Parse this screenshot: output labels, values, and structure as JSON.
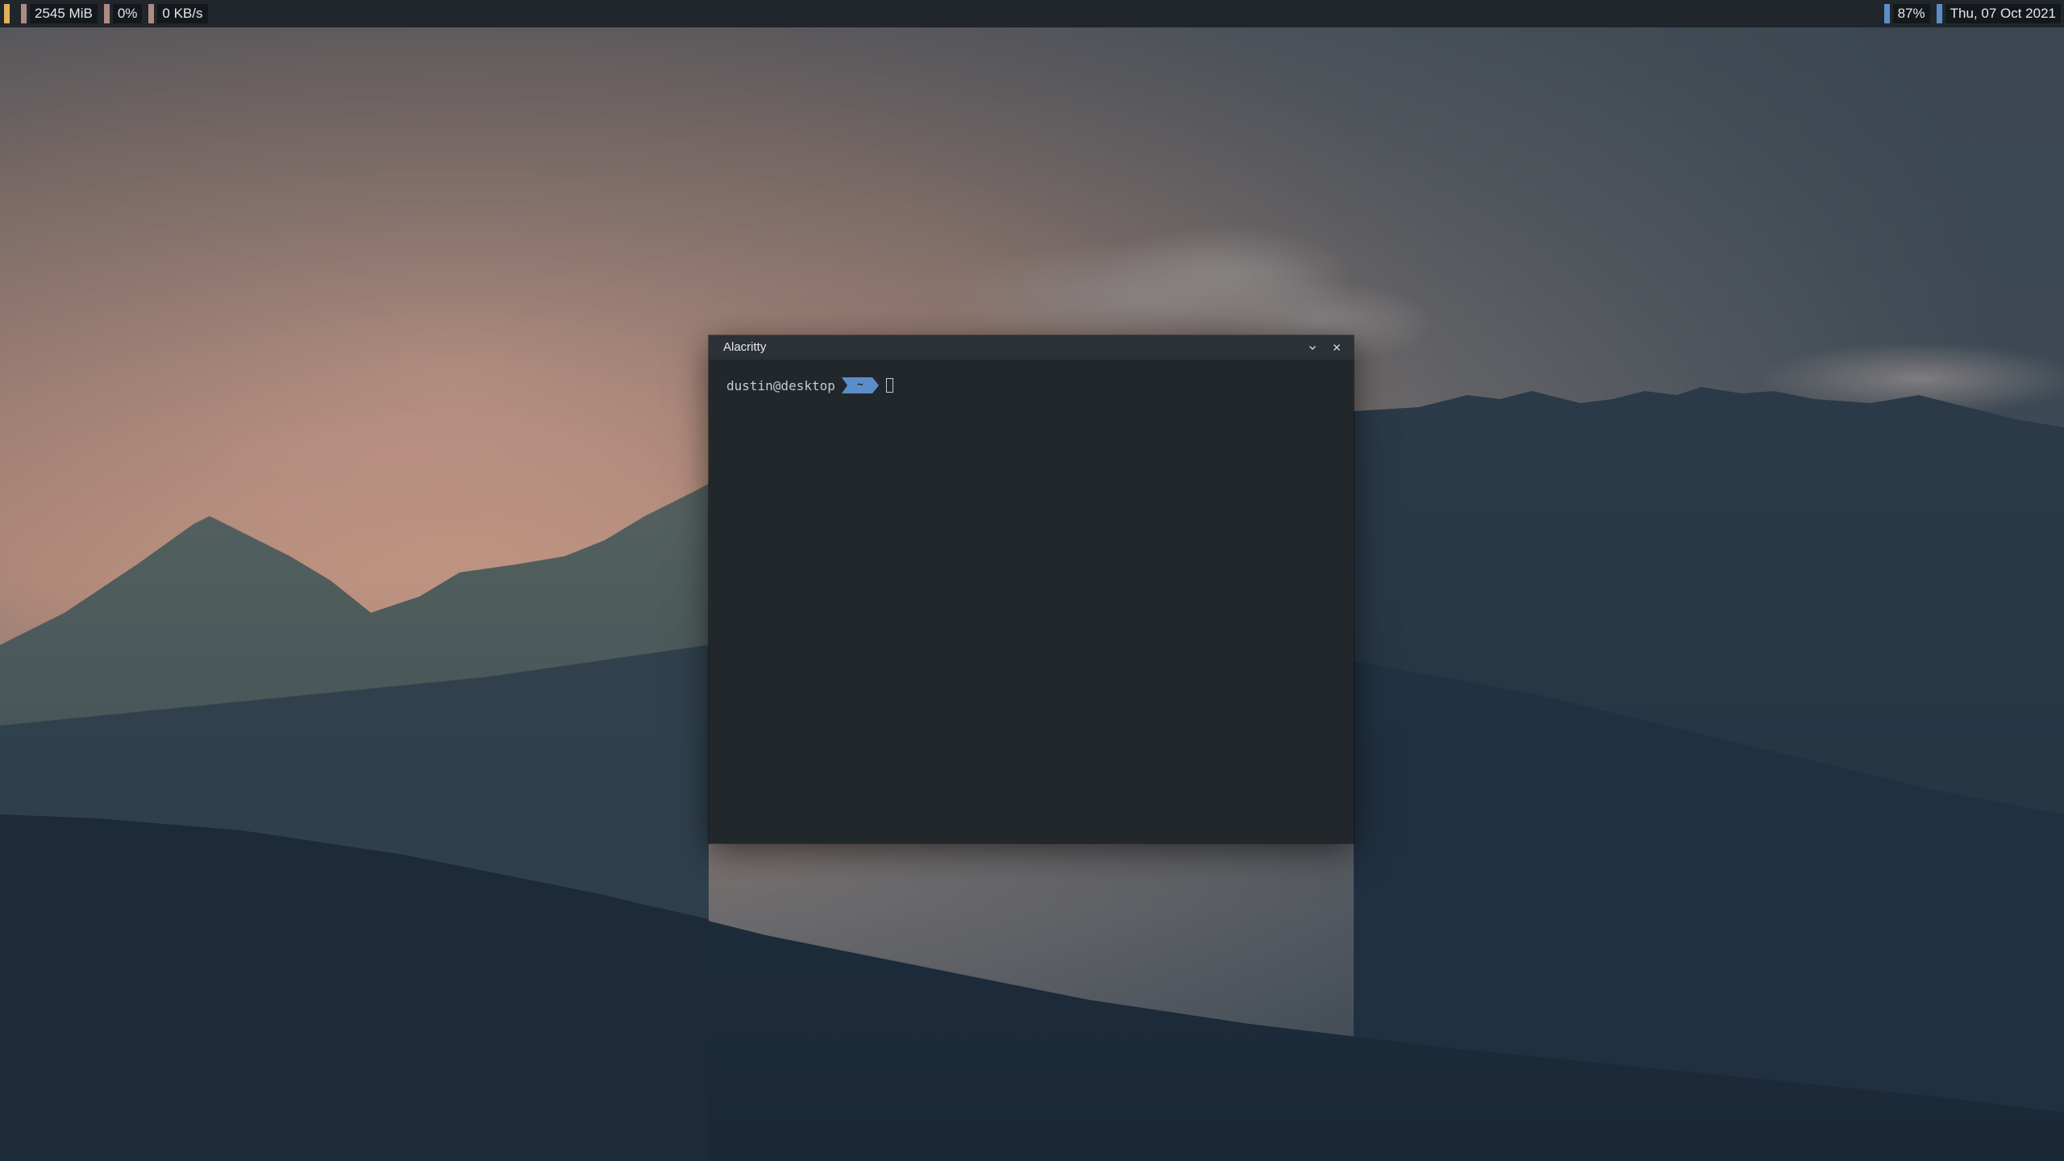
{
  "topbar": {
    "left": [
      {
        "label": "",
        "color": "#e0b05a"
      },
      {
        "label": "2545 MiB",
        "color": "#b08a84"
      },
      {
        "label": "0%",
        "color": "#b08a84"
      },
      {
        "label": "0 KB/s",
        "color": "#b08a84"
      }
    ],
    "right": [
      {
        "label": "87%",
        "color": "#5b8ec9"
      },
      {
        "label": "Thu, 07 Oct 2021",
        "color": "#5b8ec9"
      }
    ]
  },
  "window": {
    "title": "Alacritty",
    "minimize_icon": "chevron-down-icon",
    "close_icon": "close-icon"
  },
  "terminal": {
    "user_host": "dustin@desktop",
    "cwd": "~",
    "segment_color": "#5b8ec9"
  },
  "wallpaper": {
    "sky_top": "#4d5a65",
    "sky_glow": "#c79a86",
    "mountains": "#2c3e4c",
    "foreground": "#1b2a3a"
  }
}
